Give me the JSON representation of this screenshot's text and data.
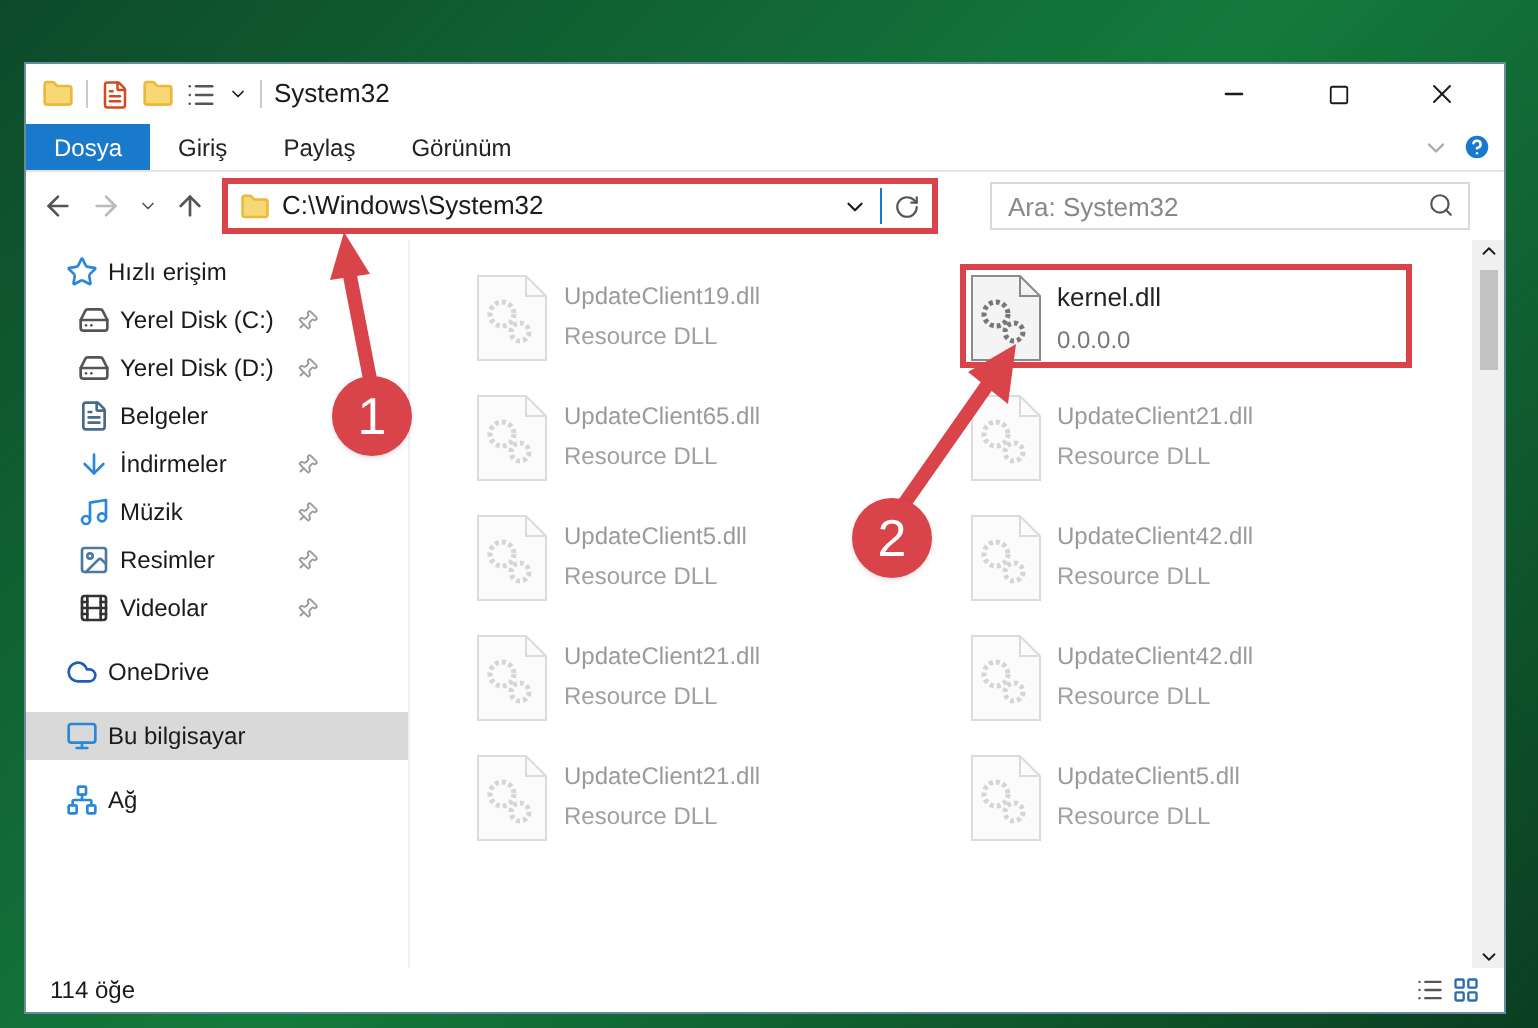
{
  "window": {
    "title": "System32"
  },
  "ribbon_tabs": [
    {
      "label": "Dosya",
      "selected": true
    },
    {
      "label": "Giriş",
      "selected": false
    },
    {
      "label": "Paylaş",
      "selected": false
    },
    {
      "label": "Görünüm",
      "selected": false
    }
  ],
  "address_bar": {
    "path": "C:\\Windows\\System32",
    "highlighted": true
  },
  "search": {
    "placeholder": "Ara: System32"
  },
  "sidebar": {
    "items": [
      {
        "kind": "star",
        "label": "Hızlı erişim",
        "pinned": false,
        "selected": false,
        "group": true
      },
      {
        "kind": "drive-c",
        "label": "Yerel Disk (C:)",
        "pinned": true,
        "selected": false,
        "group": false
      },
      {
        "kind": "drive",
        "label": "Yerel Disk (D:)",
        "pinned": true,
        "selected": false,
        "group": false
      },
      {
        "kind": "document",
        "label": "Belgeler",
        "pinned": false,
        "selected": false,
        "group": false
      },
      {
        "kind": "download",
        "label": "İndirmeler",
        "pinned": true,
        "selected": false,
        "group": false
      },
      {
        "kind": "music",
        "label": "Müzik",
        "pinned": true,
        "selected": false,
        "group": false
      },
      {
        "kind": "picture",
        "label": "Resimler",
        "pinned": true,
        "selected": false,
        "group": false
      },
      {
        "kind": "video",
        "label": "Videolar",
        "pinned": true,
        "selected": false,
        "group": false
      },
      {
        "kind": "cloud",
        "label": "OneDrive",
        "pinned": false,
        "selected": false,
        "group": true
      },
      {
        "kind": "computer",
        "label": "Bu bilgisayar",
        "pinned": false,
        "selected": true,
        "group": true
      },
      {
        "kind": "network",
        "label": "Ağ",
        "pinned": false,
        "selected": false,
        "group": true
      }
    ]
  },
  "files": [
    {
      "name": "UpdateClient19.dll",
      "subtitle": "Resource DLL",
      "dimmed": true,
      "highlighted": false
    },
    {
      "name": "kernel.dll",
      "subtitle": "0.0.0.0",
      "dimmed": false,
      "highlighted": true
    },
    {
      "name": "UpdateClient65.dll",
      "subtitle": "Resource DLL",
      "dimmed": true,
      "highlighted": false
    },
    {
      "name": "UpdateClient21.dll",
      "subtitle": "Resource DLL",
      "dimmed": true,
      "highlighted": false
    },
    {
      "name": "UpdateClient5.dll",
      "subtitle": "Resource DLL",
      "dimmed": true,
      "highlighted": false
    },
    {
      "name": "UpdateClient42.dll",
      "subtitle": "Resource DLL",
      "dimmed": true,
      "highlighted": false
    },
    {
      "name": "UpdateClient21.dll",
      "subtitle": "Resource DLL",
      "dimmed": true,
      "highlighted": false
    },
    {
      "name": "UpdateClient42.dll",
      "subtitle": "Resource DLL",
      "dimmed": true,
      "highlighted": false
    },
    {
      "name": "UpdateClient21.dll",
      "subtitle": "Resource DLL",
      "dimmed": true,
      "highlighted": false
    },
    {
      "name": "UpdateClient5.dll",
      "subtitle": "Resource DLL",
      "dimmed": true,
      "highlighted": false
    }
  ],
  "status_bar": {
    "item_count": "114 öğe"
  },
  "annotations": [
    {
      "number": "1"
    },
    {
      "number": "2"
    }
  ]
}
